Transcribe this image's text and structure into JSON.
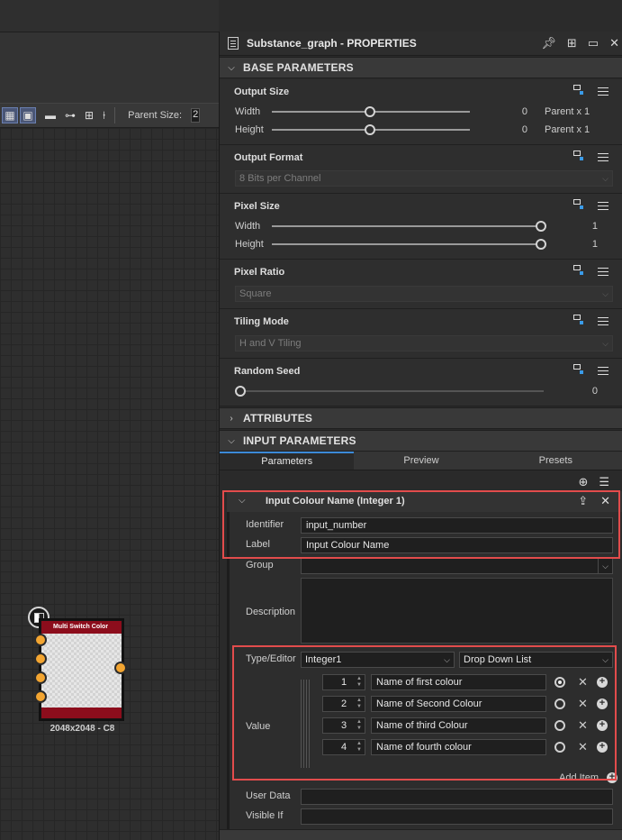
{
  "graph": {
    "toolbar": {
      "parent_size_label": "Parent Size:",
      "parent_size_value": "2",
      "icons": [
        "view-mode-icon",
        "comment-icon",
        "frame-icon",
        "pin-icon",
        "text-icon"
      ]
    },
    "node": {
      "title": "Multi Switch Color",
      "caption": "2048x2048 - C8",
      "header_color": "#8c0d1c",
      "port_color": "#f3a531"
    }
  },
  "panel": {
    "title": "Substance_graph - PROPERTIES",
    "base_parameters": {
      "header": "BASE PARAMETERS",
      "output_size": {
        "title": "Output Size",
        "width_label": "Width",
        "width_value": "0",
        "width_suffix": "Parent x 1",
        "height_label": "Height",
        "height_value": "0",
        "height_suffix": "Parent x 1"
      },
      "output_format": {
        "title": "Output Format",
        "value": "8 Bits per Channel"
      },
      "pixel_size": {
        "title": "Pixel Size",
        "width_label": "Width",
        "width_value": "1",
        "height_label": "Height",
        "height_value": "1"
      },
      "pixel_ratio": {
        "title": "Pixel Ratio",
        "value": "Square"
      },
      "tiling_mode": {
        "title": "Tiling Mode",
        "value": "H and V Tiling"
      },
      "random_seed": {
        "title": "Random Seed",
        "value": "0"
      }
    },
    "attributes": {
      "header": "ATTRIBUTES"
    },
    "input_parameters": {
      "header": "INPUT PARAMETERS",
      "tabs": [
        "Parameters",
        "Preview",
        "Presets"
      ],
      "param": {
        "title": "Input Colour Name (Integer 1)",
        "identifier_label": "Identifier",
        "identifier_value": "input_number",
        "label_label": "Label",
        "label_value": "Input Colour Name",
        "group_label": "Group",
        "group_value": "",
        "description_label": "Description",
        "type_editor_label": "Type/Editor",
        "type_value": "Integer1",
        "editor_value": "Drop Down List",
        "value_label": "Value",
        "items": [
          {
            "num": "1",
            "name": "Name of first colour",
            "selected": true
          },
          {
            "num": "2",
            "name": "Name of Second Colour",
            "selected": false
          },
          {
            "num": "3",
            "name": "Name of third Colour",
            "selected": false
          },
          {
            "num": "4",
            "name": "Name of fourth colour",
            "selected": false
          }
        ],
        "add_item_label": "Add Item",
        "user_data_label": "User Data",
        "visible_if_label": "Visible If"
      }
    },
    "highlight_color": "#e24c4c",
    "tab_accent_color": "#3c8ad8"
  }
}
